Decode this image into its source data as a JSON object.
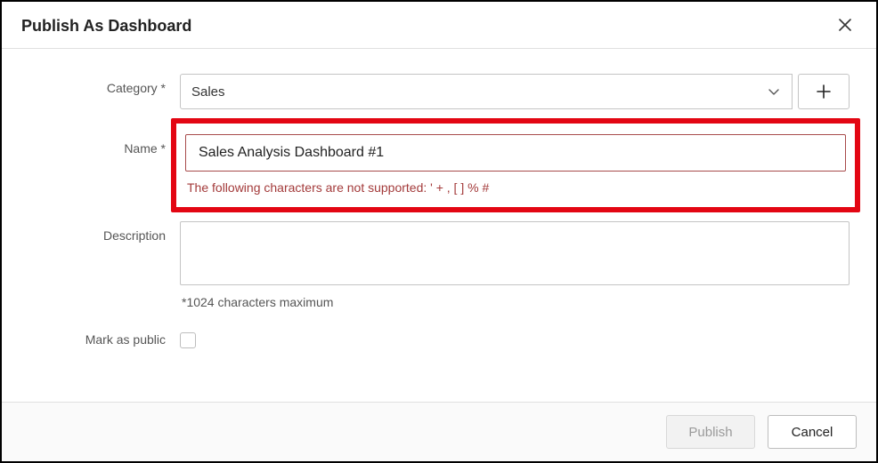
{
  "dialog": {
    "title": "Publish As Dashboard"
  },
  "form": {
    "category": {
      "label": "Category *",
      "value": "Sales"
    },
    "name": {
      "label": "Name *",
      "value": "Sales Analysis Dashboard #1",
      "error": "The following characters are not supported:   ' + ,  [ ] % #"
    },
    "description": {
      "label": "Description",
      "value": "",
      "hint": "*1024 characters maximum"
    },
    "public": {
      "label": "Mark as public",
      "checked": false
    }
  },
  "footer": {
    "publish": "Publish",
    "cancel": "Cancel"
  }
}
